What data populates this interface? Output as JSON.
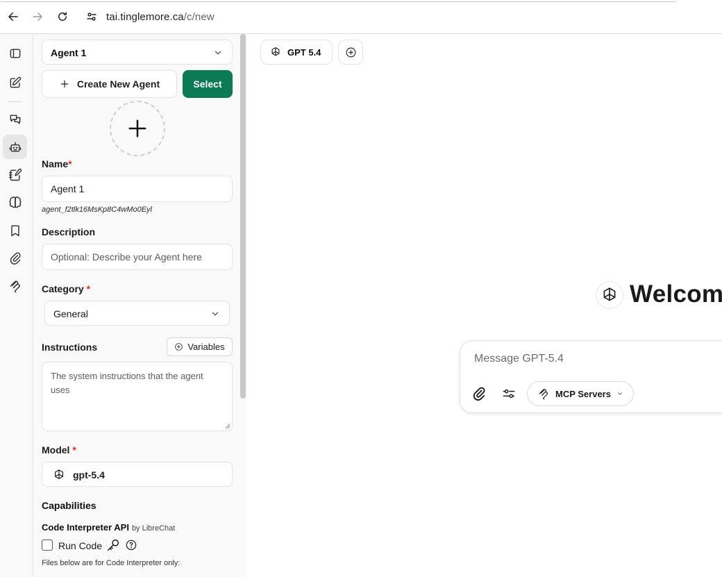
{
  "browser": {
    "url_host": "tai.tinglemore.ca",
    "url_path": "/c/new"
  },
  "rail": {
    "items": [
      {
        "name": "sidebar-toggle"
      },
      {
        "name": "new-chat"
      },
      {
        "name": "conversations"
      },
      {
        "name": "agent-builder",
        "active": true
      },
      {
        "name": "prompts"
      },
      {
        "name": "memories"
      },
      {
        "name": "bookmarks"
      },
      {
        "name": "attachments"
      },
      {
        "name": "mcp"
      }
    ]
  },
  "agent_panel": {
    "agent_select": "Agent 1",
    "create_new_label": "Create New Agent",
    "select_label": "Select",
    "name_label": "Name",
    "name_value": "Agent 1",
    "agent_id": "agent_f2tlk16MsKp8C4wMo0Eyl",
    "description_label": "Description",
    "description_placeholder": "Optional: Describe your Agent here",
    "category_label": "Category",
    "category_value": "General",
    "instructions_label": "Instructions",
    "variables_label": "Variables",
    "instructions_placeholder": "The system instructions that the agent uses",
    "model_label": "Model",
    "model_value": "gpt-5.4",
    "capabilities_label": "Capabilities",
    "code_interpreter_label": "Code Interpreter API",
    "code_interpreter_by": "by LibreChat",
    "run_code_label": "Run Code",
    "files_note": "Files below are for Code Interpreter only:",
    "required_mark": "*"
  },
  "main": {
    "model_pill": "GPT 5.4",
    "welcome": "Welcom",
    "composer_placeholder": "Message GPT-5.4",
    "mcp_label": "MCP Servers"
  },
  "colors": {
    "accent_green": "#0b7a55",
    "required_red": "#d93025"
  }
}
